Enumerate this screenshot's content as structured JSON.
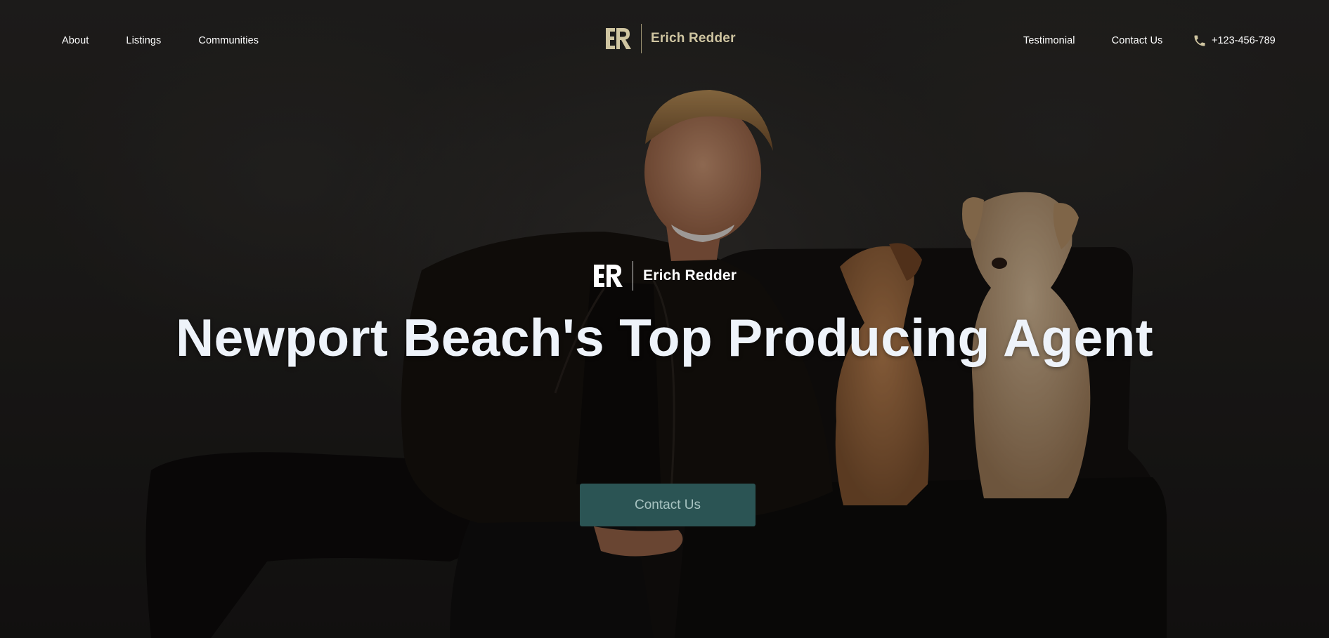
{
  "nav": {
    "left": [
      {
        "label": "About"
      },
      {
        "label": "Listings"
      },
      {
        "label": "Communities"
      }
    ],
    "right": [
      {
        "label": "Testimonial"
      },
      {
        "label": "Contact Us"
      }
    ],
    "phone": "+123-456-789",
    "phone_icon": "phone-icon"
  },
  "brand": {
    "name": "Erich Redder",
    "top_color": "#cfc5a1",
    "center_color": "#ffffff"
  },
  "hero": {
    "headline": "Newport Beach's Top Producing Agent",
    "cta_label": "Contact Us",
    "cta_color": "#2b5454"
  }
}
